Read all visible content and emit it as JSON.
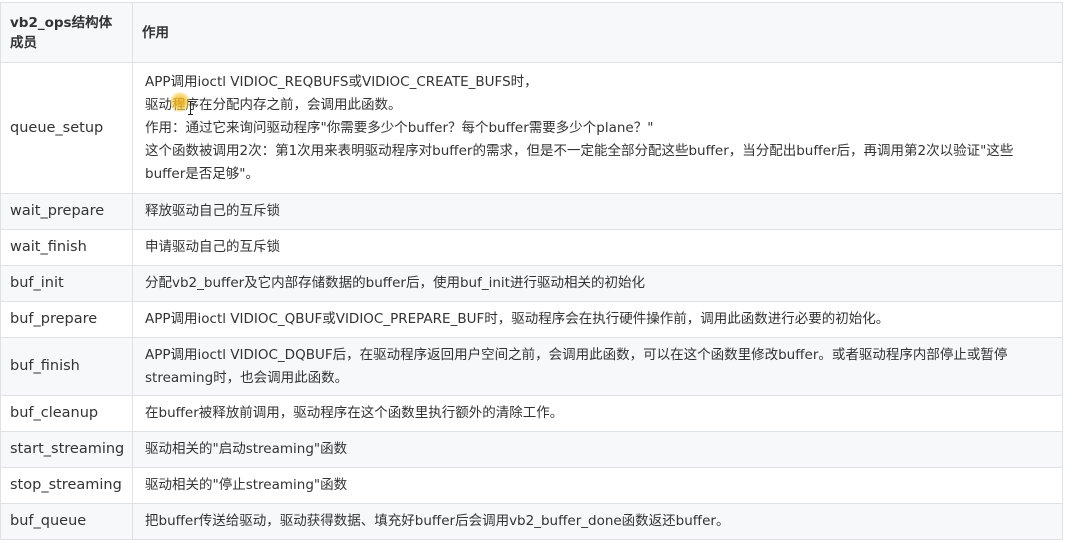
{
  "table": {
    "header": {
      "col1": "vb2_ops结构体成员",
      "col2": "作用"
    },
    "rows": [
      {
        "member": "queue_setup",
        "desc": [
          "APP调用ioctl VIDIOC_REQBUFS或VIDIOC_CREATE_BUFS时，",
          "驱动程序在分配内存之前，会调用此函数。",
          "作用：通过它来询问驱动程序\"你需要多少个buffer？每个buffer需要多少个plane？\"",
          "这个函数被调用2次：第1次用来表明驱动程序对buffer的需求，但是不一定能全部分配这些buffer，当分配出buffer后，再调用第2次以验证\"这些buffer是否足够\"。"
        ]
      },
      {
        "member": "wait_prepare",
        "desc": [
          "释放驱动自己的互斥锁"
        ]
      },
      {
        "member": "wait_finish",
        "desc": [
          "申请驱动自己的互斥锁"
        ]
      },
      {
        "member": "buf_init",
        "desc": [
          "分配vb2_buffer及它内部存储数据的buffer后，使用buf_init进行驱动相关的初始化"
        ]
      },
      {
        "member": "buf_prepare",
        "desc": [
          "APP调用ioctl VIDIOC_QBUF或VIDIOC_PREPARE_BUF时，驱动程序会在执行硬件操作前，调用此函数进行必要的初始化。"
        ]
      },
      {
        "member": "buf_finish",
        "desc": [
          "APP调用ioctl VIDIOC_DQBUF后，在驱动程序返回用户空间之前，会调用此函数，可以在这个函数里修改buffer。或者驱动程序内部停止或暂停streaming时，也会调用此函数。"
        ]
      },
      {
        "member": "buf_cleanup",
        "desc": [
          "在buffer被释放前调用，驱动程序在这个函数里执行额外的清除工作。"
        ]
      },
      {
        "member": "start_streaming",
        "desc": [
          "驱动相关的\"启动streaming\"函数"
        ]
      },
      {
        "member": "stop_streaming",
        "desc": [
          "驱动相关的\"停止streaming\"函数"
        ]
      },
      {
        "member": "buf_queue",
        "desc": [
          "把buffer传送给驱动，驱动获得数据、填充好buffer后会调用vb2_buffer_done函数返还buffer。"
        ]
      }
    ]
  }
}
